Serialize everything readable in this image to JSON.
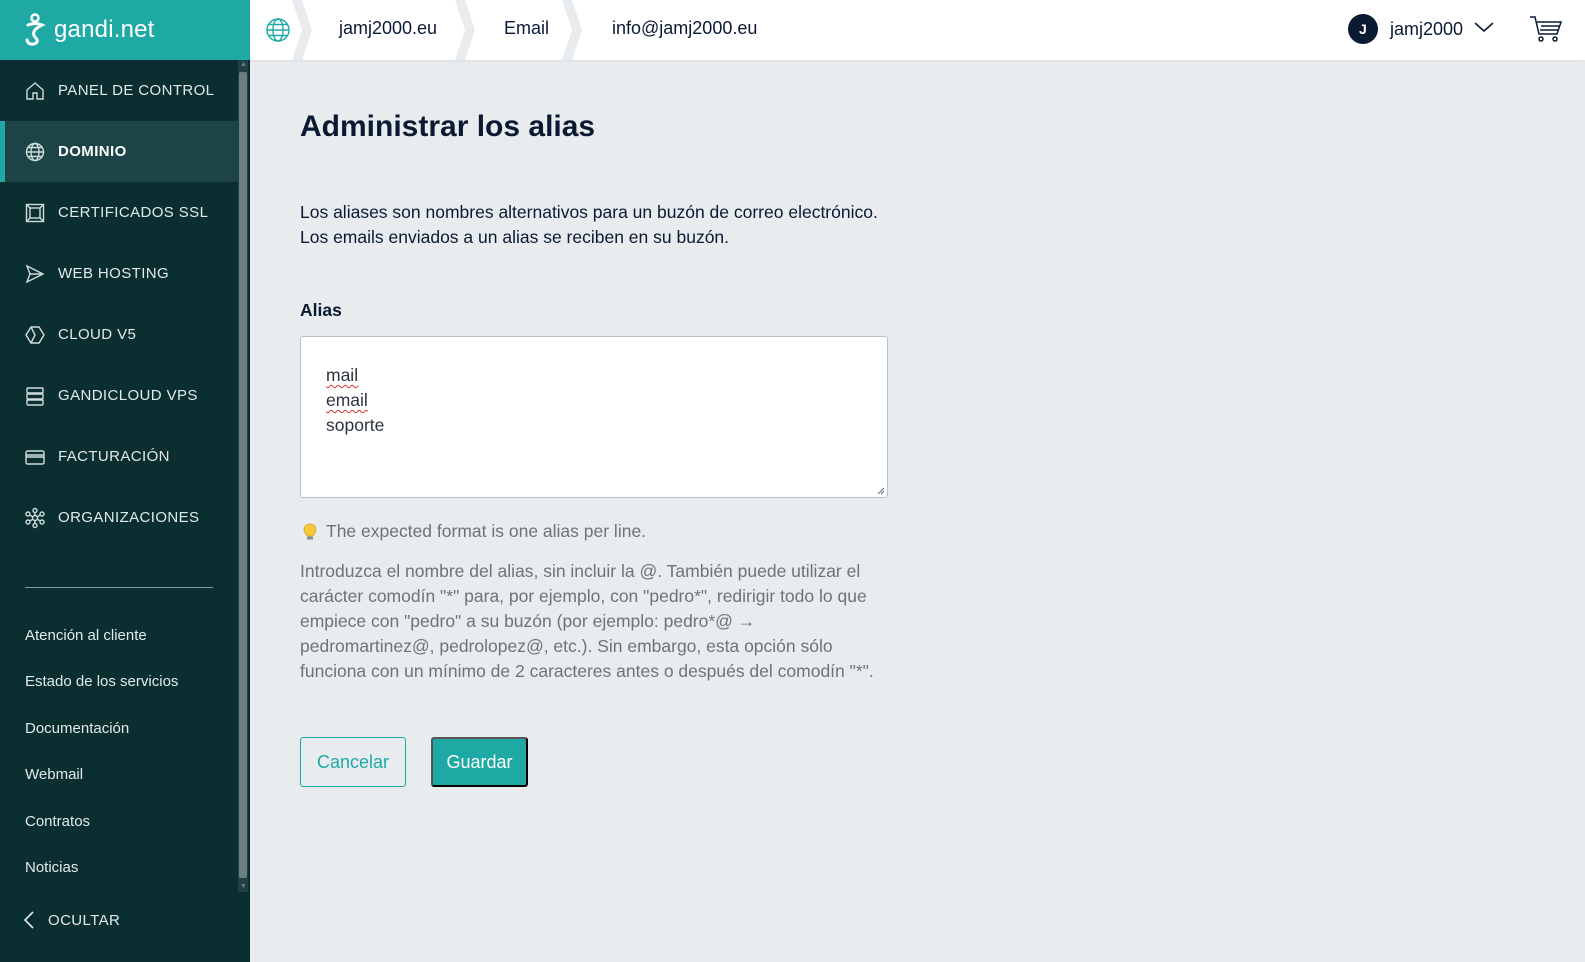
{
  "brand": {
    "logo_text": "gandi.net",
    "accent": "#1ea9a5",
    "sidebar_bg": "#0b2f30"
  },
  "breadcrumb": [
    "jamj2000.eu",
    "Email",
    "info@jamj2000.eu"
  ],
  "user": {
    "initial": "J",
    "name": "jamj2000"
  },
  "sidebar": {
    "items": [
      {
        "label": "PANEL DE CONTROL",
        "icon": "home-icon"
      },
      {
        "label": "DOMINIO",
        "icon": "globe-icon",
        "active": true
      },
      {
        "label": "CERTIFICADOS SSL",
        "icon": "certificate-icon"
      },
      {
        "label": "WEB HOSTING",
        "icon": "paper-plane-icon"
      },
      {
        "label": "CLOUD V5",
        "icon": "hexagon-icon"
      },
      {
        "label": "GANDICLOUD VPS",
        "icon": "server-stack-icon"
      },
      {
        "label": "FACTURACIÓN",
        "icon": "credit-card-icon"
      },
      {
        "label": "ORGANIZACIONES",
        "icon": "network-icon"
      }
    ],
    "links": [
      "Atención al cliente",
      "Estado de los servicios",
      "Documentación",
      "Webmail",
      "Contratos",
      "Noticias"
    ],
    "hide_label": "OCULTAR"
  },
  "main": {
    "title": "Administrar los alias",
    "description": "Los aliases son nombres alternativos para un buzón de correo electrónico. Los emails enviados a un alias se reciben en su buzón.",
    "alias_label": "Alias",
    "aliases": [
      "mail",
      "email",
      "soporte"
    ],
    "hint": "The expected format is one alias per line.",
    "help": "Introduzca el nombre del alias, sin incluir la @. También puede utilizar el carácter comodín \"*\" para, por ejemplo, con \"pedro*\", redirigir todo lo que empiece con \"pedro\" a su buzón (por ejemplo: pedro*@ → pedromartinez@, pedrolopez@, etc.). Sin embargo, esta opción sólo funciona con un mínimo de 2 caracteres antes o después del comodín \"*\".",
    "cancel_label": "Cancelar",
    "save_label": "Guardar"
  }
}
